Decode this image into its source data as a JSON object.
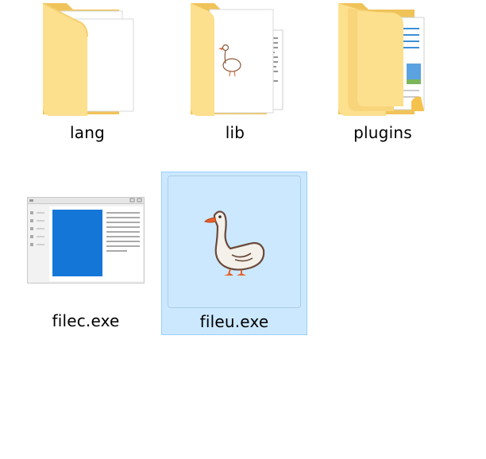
{
  "items": [
    {
      "name": "lang",
      "type": "folder"
    },
    {
      "name": "lib",
      "type": "folder"
    },
    {
      "name": "plugins",
      "type": "folder"
    },
    {
      "name": "filec.exe",
      "type": "application"
    },
    {
      "name": "fileu.exe",
      "type": "application",
      "selected": true
    }
  ],
  "colors": {
    "folder_back": "#f0c35a",
    "folder_front": "#fde08e",
    "selection_bg": "#cce8ff",
    "selection_border": "#99d1ff",
    "app_blue": "#1477d8"
  },
  "icons": [
    "folder-icon",
    "folder-icon",
    "folder-icon",
    "application-window-icon",
    "goose-icon"
  ]
}
